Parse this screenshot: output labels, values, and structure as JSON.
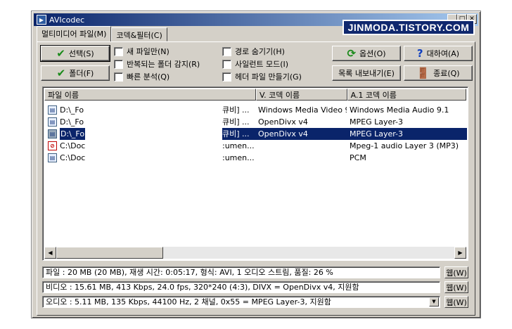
{
  "window": {
    "title": "AVIcodec",
    "watermark": "JINMODA.TISTORY.COM",
    "controls": {
      "minimize": "_",
      "maximize": "□",
      "close": "✕"
    }
  },
  "tabs": [
    {
      "label": "멀티미디어 파일(M)",
      "active": true
    },
    {
      "label": "코덱&필터(C)",
      "active": false
    }
  ],
  "buttons": {
    "select": "선택(S)",
    "folder": "폴더(F)",
    "options": "옵션(O)",
    "about": "대하여(A)",
    "export_list": "목록 내보내기(E)",
    "exit": "종료(Q)"
  },
  "checkboxes": [
    {
      "label": "새 파일만(N)",
      "checked": false
    },
    {
      "label": "반복되는 폴더 감지(R)",
      "checked": false
    },
    {
      "label": "빠른 분석(Q)",
      "checked": false
    },
    {
      "label": "경로 숨기기(H)",
      "checked": false
    },
    {
      "label": "사일런트 모드(I)",
      "checked": false
    },
    {
      "label": "헤더 파일 만들기(G)",
      "checked": false
    }
  ],
  "list": {
    "columns": [
      "파일 이름",
      "V. 코덱 이름",
      "A.1 코덱 이름"
    ],
    "rows": [
      {
        "icon": "video-file-icon",
        "name": "D:\\_Fo",
        "mid": "큐비] ...",
        "vcodec": "Windows Media Video 9",
        "acodec": "Windows Media Audio 9.1",
        "selected": false
      },
      {
        "icon": "video-file-icon",
        "name": "D:\\_Fo",
        "mid": "큐비] ...",
        "vcodec": "OpenDivx v4",
        "acodec": "MPEG Layer-3",
        "selected": false
      },
      {
        "icon": "video-file-icon",
        "name": "D:\\_Fo",
        "mid": "큐비] ...",
        "vcodec": "OpenDivx v4",
        "acodec": "MPEG Layer-3",
        "selected": true
      },
      {
        "icon": "error-file-icon",
        "name": "C:\\Doc",
        "mid": ":umen...",
        "vcodec": "",
        "acodec": "Mpeg-1 audio Layer 3 (MP3)",
        "selected": false
      },
      {
        "icon": "video-file-icon",
        "name": "C:\\Doc",
        "mid": ":umen...",
        "vcodec": "",
        "acodec": "PCM",
        "selected": false
      }
    ]
  },
  "info": {
    "file": "파일   : 20 MB (20 MB), 재생 시간: 0:05:17, 형식: AVI, 1 오디오 스트림, 품질: 26 %",
    "video": "비디오 : 15.61 MB,  413 Kbps,  24.0 fps,  320*240 (4:3),  DIVX = OpenDivx v4,   지원함",
    "audio": "오디오 :  5.11 MB,  135 Kbps,  44100 Hz,  2 채널,  0x55 = MPEG Layer-3,   지원함",
    "web_label": "웹(W)"
  }
}
